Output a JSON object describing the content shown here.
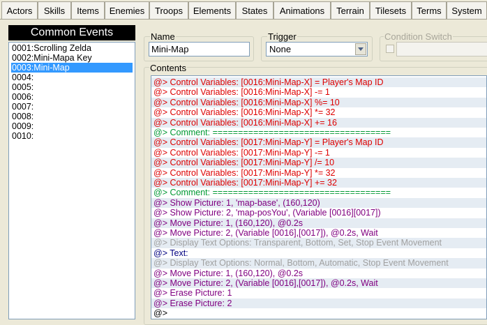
{
  "tabs": [
    {
      "label": "Actors"
    },
    {
      "label": "Skills"
    },
    {
      "label": "Items"
    },
    {
      "label": "Enemies"
    },
    {
      "label": "Troops"
    },
    {
      "label": "Elements"
    },
    {
      "label": "States"
    },
    {
      "label": "Animations"
    },
    {
      "label": "Terrain"
    },
    {
      "label": "Tilesets"
    },
    {
      "label": "Terms"
    },
    {
      "label": "System"
    }
  ],
  "common_events": {
    "title": "Common Events",
    "items": [
      {
        "label": "0001:Scrolling Zelda"
      },
      {
        "label": "0002:Mini-Mapa Key"
      },
      {
        "label": "0003:Mini-Map"
      },
      {
        "label": "0004:"
      },
      {
        "label": "0005:"
      },
      {
        "label": "0006:"
      },
      {
        "label": "0007:"
      },
      {
        "label": "0008:"
      },
      {
        "label": "0009:"
      },
      {
        "label": "0010:"
      }
    ],
    "selected_index": 2
  },
  "name": {
    "label": "Name",
    "value": "Mini-Map"
  },
  "trigger": {
    "label": "Trigger",
    "value": "None"
  },
  "condition_switch": {
    "label": "Condition Switch"
  },
  "contents": {
    "label": "Contents",
    "lines": [
      {
        "text": "@> Control Variables: [0016:Mini-Map-X] = Player's Map ID",
        "color": "#dd0000"
      },
      {
        "text": "@> Control Variables: [0016:Mini-Map-X] -= 1",
        "color": "#dd0000"
      },
      {
        "text": "@> Control Variables: [0016:Mini-Map-X] %= 10",
        "color": "#dd0000"
      },
      {
        "text": "@> Control Variables: [0016:Mini-Map-X] *= 32",
        "color": "#dd0000"
      },
      {
        "text": "@> Control Variables: [0016:Mini-Map-X] += 16",
        "color": "#dd0000"
      },
      {
        "text": "@> Comment: ===================================",
        "color": "#009933"
      },
      {
        "text": "@> Control Variables: [0017:Mini-Map-Y] = Player's Map ID",
        "color": "#dd0000"
      },
      {
        "text": "@> Control Variables: [0017:Mini-Map-Y] -= 1",
        "color": "#dd0000"
      },
      {
        "text": "@> Control Variables: [0017:Mini-Map-Y] /= 10",
        "color": "#dd0000"
      },
      {
        "text": "@> Control Variables: [0017:Mini-Map-Y] *= 32",
        "color": "#dd0000"
      },
      {
        "text": "@> Control Variables: [0017:Mini-Map-Y] += 32",
        "color": "#dd0000"
      },
      {
        "text": "@> Comment: ===================================",
        "color": "#009933"
      },
      {
        "text": "@> Show Picture: 1, 'map-base', (160,120)",
        "color": "#800080"
      },
      {
        "text": "@> Show Picture: 2, 'map-posYou', (Variable [0016][0017])",
        "color": "#800080"
      },
      {
        "text": "@> Move Picture: 1, (160,120), @0.2s",
        "color": "#800080"
      },
      {
        "text": "@> Move Picture: 2, (Variable [0016],[0017]), @0.2s, Wait",
        "color": "#800080"
      },
      {
        "text": "@> Display Text Options: Transparent, Bottom, Set, Stop Event Movement",
        "color": "#a0a0a0"
      },
      {
        "text": "@> Text:",
        "color": "#000080"
      },
      {
        "text": "@> Display Text Options: Normal, Bottom, Automatic, Stop Event Movement",
        "color": "#a0a0a0"
      },
      {
        "text": "@> Move Picture: 1, (160,120), @0.2s",
        "color": "#800080"
      },
      {
        "text": "@> Move Picture: 2, (Variable [0016],[0017]), @0.2s, Wait",
        "color": "#800080"
      },
      {
        "text": "@> Erase Picture: 1",
        "color": "#800080"
      },
      {
        "text": "@> Erase Picture: 2",
        "color": "#800080"
      },
      {
        "text": "@>",
        "color": "#000000"
      }
    ]
  },
  "colors": {
    "selection": "#3399ff",
    "alt_row": "#e5ecf3",
    "control_variables": "#dd0000",
    "comment": "#009933",
    "picture": "#800080",
    "disabled": "#a0a0a0"
  },
  "icons": {
    "dropdown": "chevron-down-icon"
  }
}
